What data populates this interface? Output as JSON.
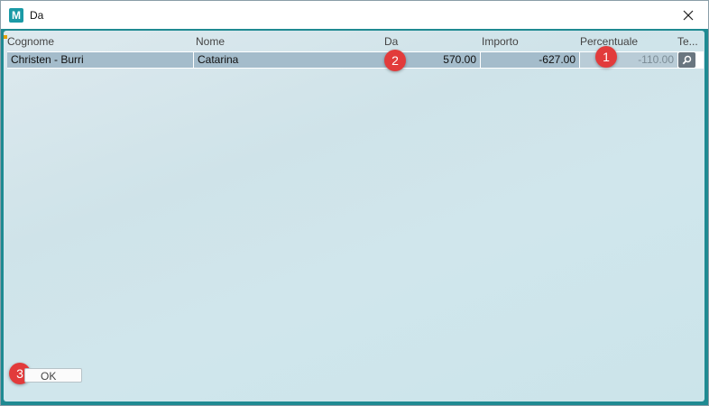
{
  "window": {
    "title": "Da",
    "icon_letter": "M"
  },
  "table": {
    "columns": [
      "Cognome",
      "Nome",
      "Da",
      "Importo",
      "Percentuale",
      "Te..."
    ],
    "rows": [
      {
        "cognome": "Christen - Burri",
        "nome": "Catarina",
        "da": "570.00",
        "importo": "-627.00",
        "percentuale": "-110.00"
      }
    ]
  },
  "badges": [
    "1",
    "2",
    "3"
  ],
  "ok_button": {
    "label": "OK"
  },
  "colors": {
    "teal_frame": "#1f8a92",
    "selected_row": "#a4bccb",
    "badge_red": "#e23b3b",
    "app_icon": "#1a9aa6"
  },
  "icons": [
    "app-logo-icon",
    "close-icon",
    "search-icon"
  ]
}
